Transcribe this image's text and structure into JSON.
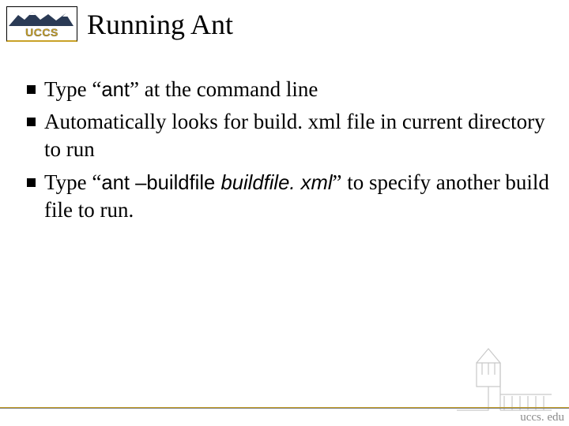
{
  "logo": {
    "name": "UCCS"
  },
  "title": "Running Ant",
  "bullets": [
    {
      "prefix": "Type “",
      "code": "ant",
      "suffix": "” at the command line"
    },
    {
      "text": "Automatically looks for build. xml file in current directory to run"
    },
    {
      "prefix": "Type “",
      "code": "ant –buildfile ",
      "code_italic": "buildfile. xml",
      "suffix": "” to specify another build file to run."
    }
  ],
  "footer": {
    "url": "uccs. edu"
  }
}
